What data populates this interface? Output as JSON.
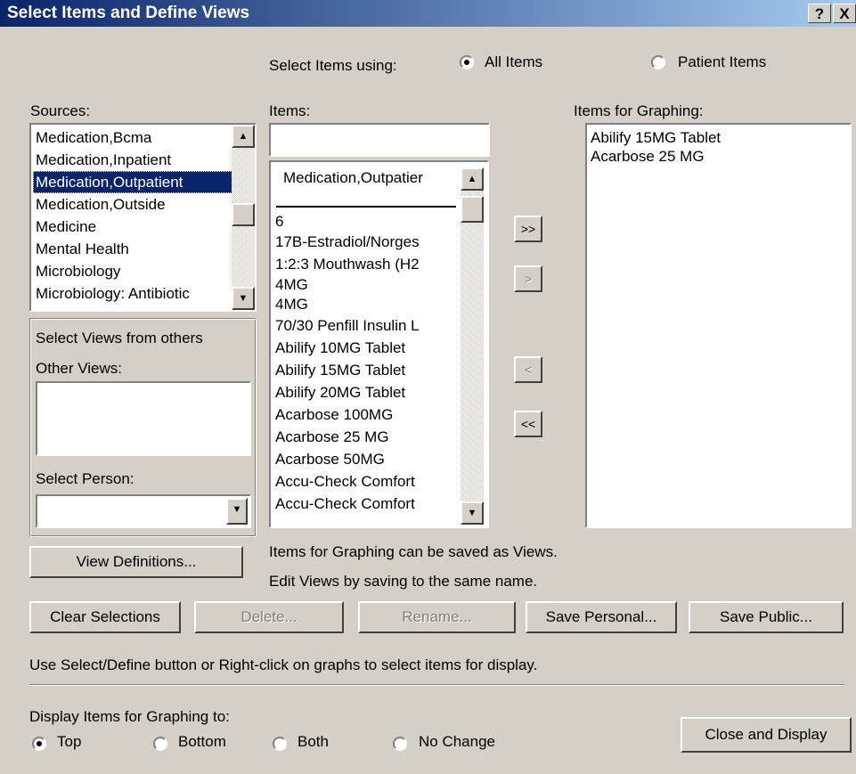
{
  "window": {
    "title": "Select Items and Define Views",
    "help_label": "?",
    "close_label": "X"
  },
  "item_mode": {
    "label": "Select Items using:",
    "options": [
      "All Items",
      "Patient Items"
    ],
    "selected": "All Items"
  },
  "sources": {
    "label": "Sources:",
    "items": [
      "Medication,Bcma",
      "Medication,Inpatient",
      "Medication,Outpatient",
      "Medication,Outside",
      "Medicine",
      "Mental Health",
      "Microbiology",
      "Microbiology: Antibiotic"
    ],
    "selected": "Medication,Outpatient"
  },
  "items": {
    "label": "Items:",
    "search_value": "",
    "header_item": "Medication,Outpatier",
    "list": [
      "6",
      "17B-Estradiol/Norges",
      "1:2:3 Mouthwash (H2",
      "4MG",
      "4MG",
      "70/30 Penfill Insulin L",
      "Abilify 10MG Tablet",
      "Abilify 15MG Tablet",
      "Abilify 20MG Tablet",
      "Acarbose 100MG",
      "Acarbose 25 MG",
      "Acarbose 50MG",
      "Accu-Check Comfort",
      "Accu-Check Comfort"
    ]
  },
  "transfer_buttons": {
    "add_all": ">>",
    "add": ">",
    "remove": "<",
    "remove_all": "<<"
  },
  "graphing": {
    "label": "Items for Graphing:",
    "items": [
      "Abilify 15MG Tablet",
      "Acarbose 25 MG"
    ]
  },
  "views": {
    "group_label": "Select Views from others",
    "other_views_label": "Other Views:",
    "select_person_label": "Select Person:",
    "select_person_value": ""
  },
  "info": {
    "line1": "Items for Graphing can be saved as Views.",
    "line2": "Edit Views by saving to the same name.",
    "hint": "Use Select/Define button or Right-click on graphs to select items for display."
  },
  "buttons": {
    "view_definitions": "View Definitions...",
    "clear_selections": "Clear Selections",
    "delete": "Delete...",
    "rename": "Rename...",
    "save_personal": "Save Personal...",
    "save_public": "Save Public...",
    "close_display": "Close and Display"
  },
  "display_to": {
    "label": "Display Items for Graphing to:",
    "options": [
      "Top",
      "Bottom",
      "Both",
      "No Change"
    ],
    "selected": "Top"
  },
  "icons": {
    "scroll_up": "▲",
    "scroll_down": "▼",
    "combo_down": "▼"
  }
}
